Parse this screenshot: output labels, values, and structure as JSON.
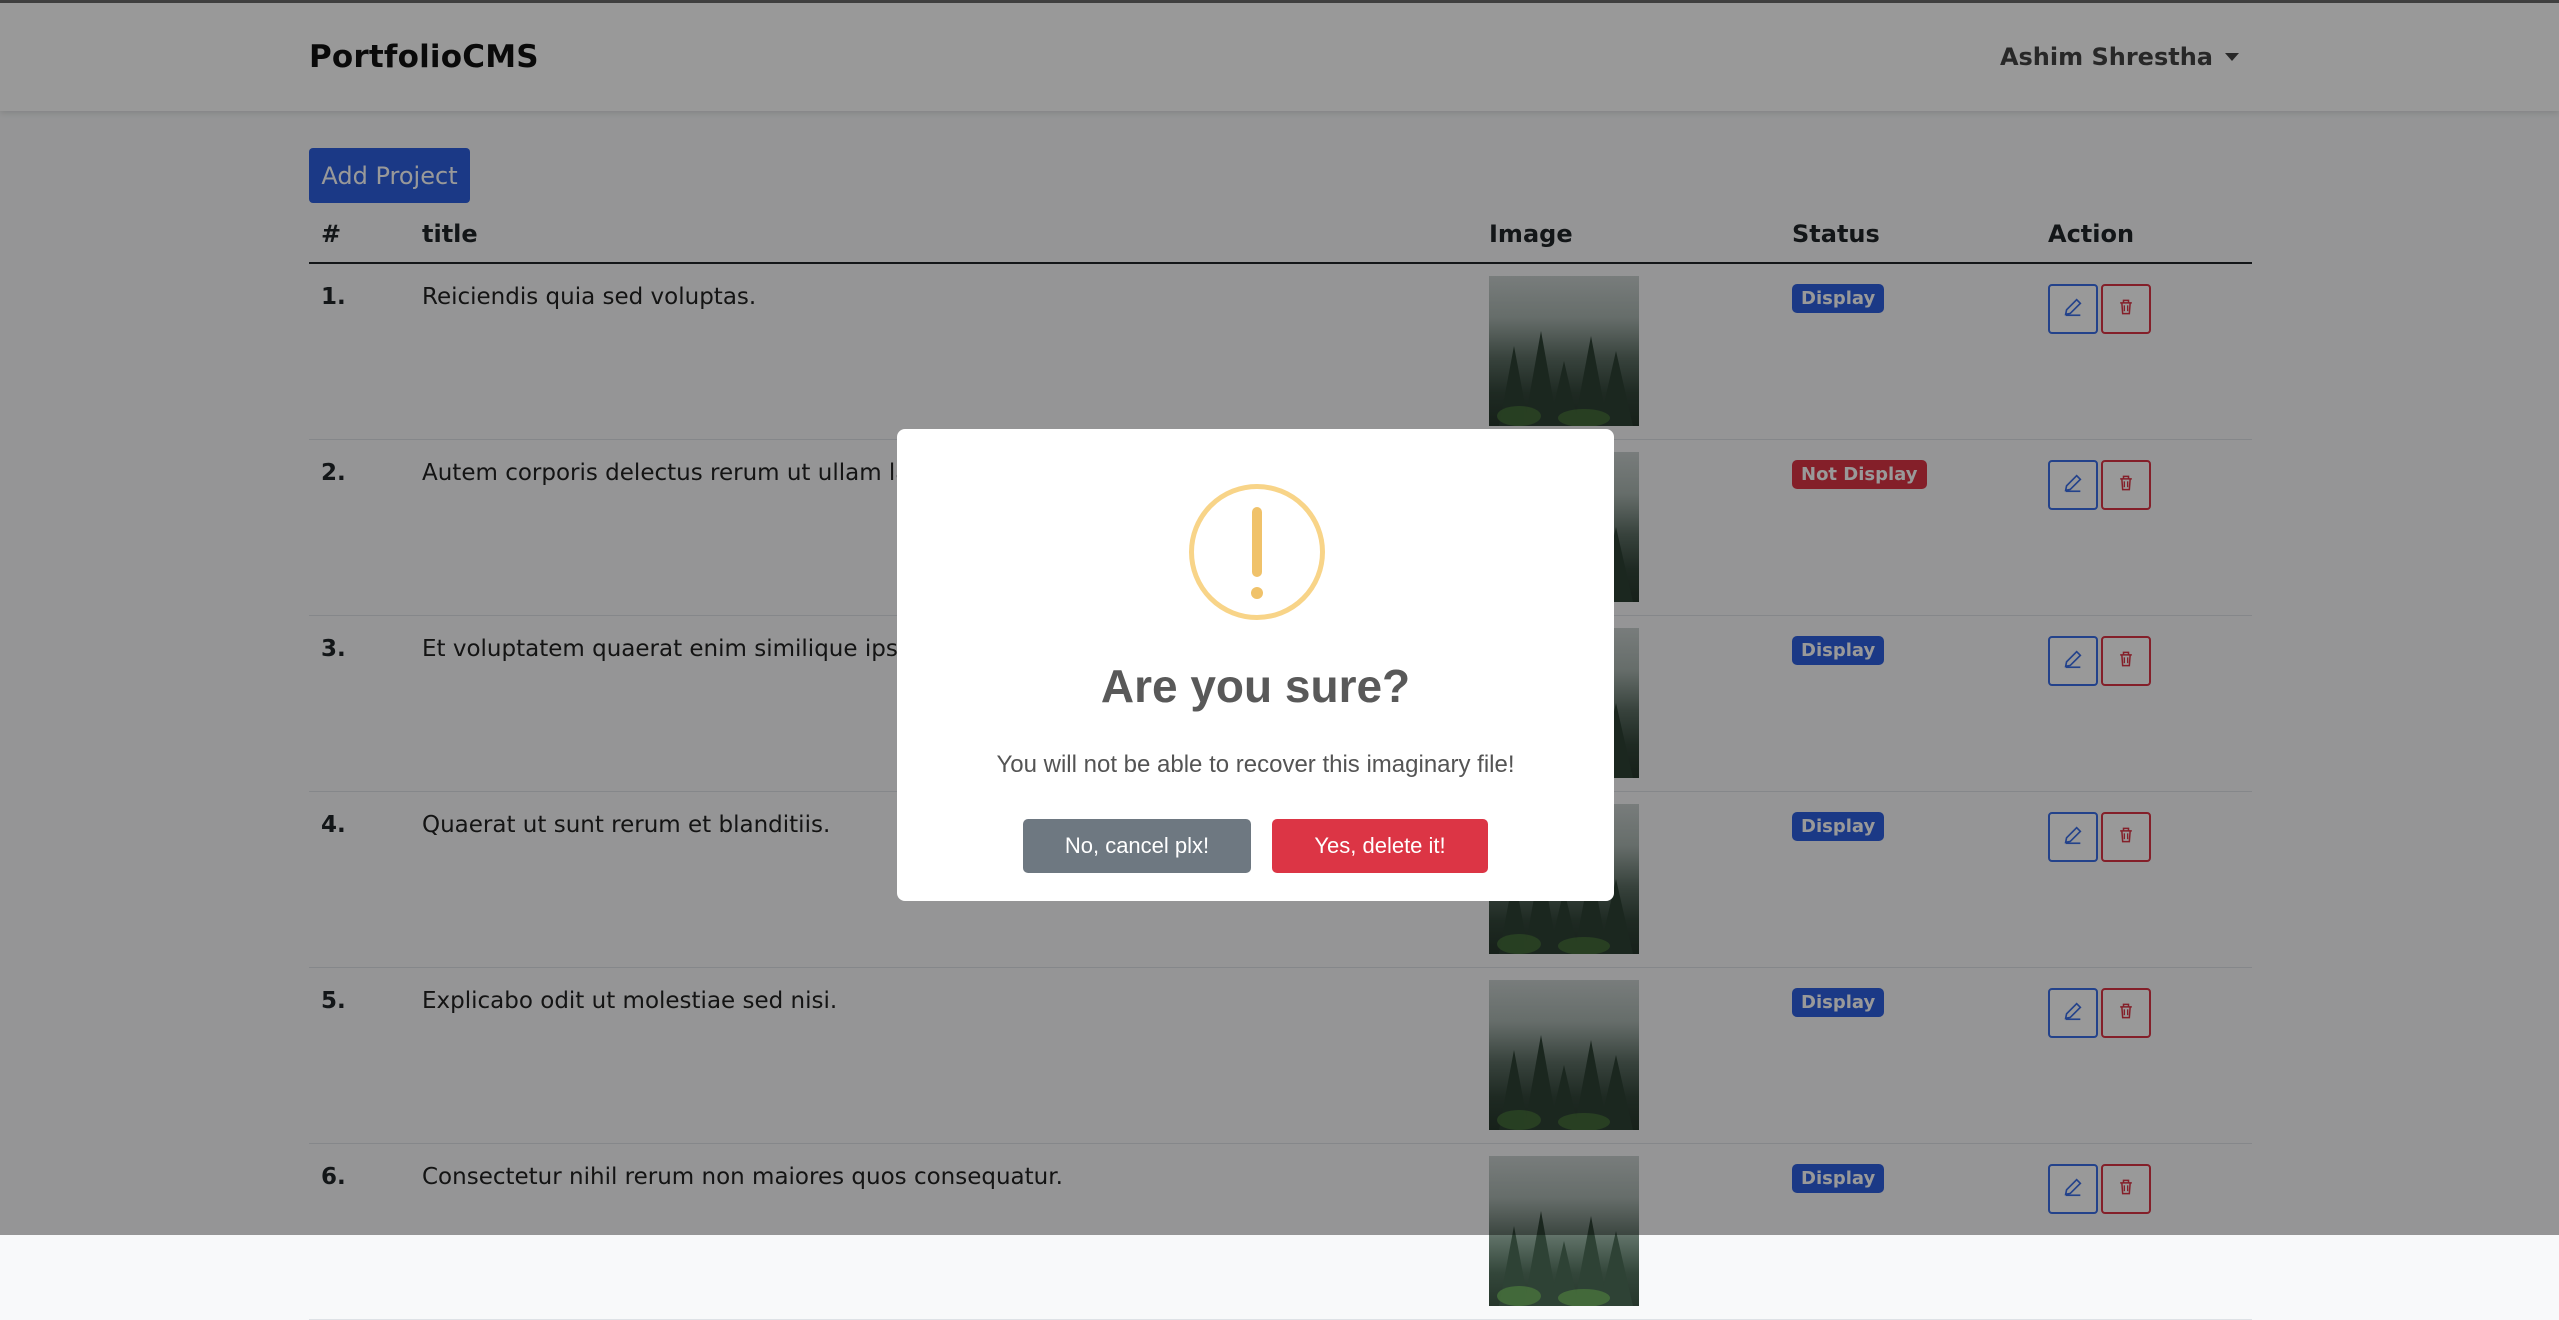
{
  "navbar": {
    "brand": "PortfolioCMS",
    "user": "Ashim Shrestha"
  },
  "actions": {
    "add_project": "Add Project"
  },
  "table": {
    "headers": {
      "num": "#",
      "title": "title",
      "image": "Image",
      "status": "Status",
      "action": "Action"
    },
    "rows": [
      {
        "num": "1.",
        "title": "Reiciendis quia sed voluptas.",
        "status": "Display"
      },
      {
        "num": "2.",
        "title": "Autem corporis delectus rerum ut ullam labo",
        "status": "Not Display"
      },
      {
        "num": "3.",
        "title": "Et voluptatem quaerat enim similique ipsam n",
        "status": "Display"
      },
      {
        "num": "4.",
        "title": "Quaerat ut sunt rerum et blanditiis.",
        "status": "Display"
      },
      {
        "num": "5.",
        "title": "Explicabo odit ut molestiae sed nisi.",
        "status": "Display"
      },
      {
        "num": "6.",
        "title": "Consectetur nihil rerum non maiores quos consequatur.",
        "status": "Display"
      }
    ]
  },
  "dialog": {
    "title": "Are you sure?",
    "text": "You will not be able to recover this imaginary file!",
    "cancel": "No, cancel plx!",
    "confirm": "Yes, delete it!"
  },
  "colors": {
    "primary": "#2d5fe0",
    "danger": "#dc3545",
    "warning_icon": "#f8d488",
    "cancel_button": "#6e7881"
  },
  "icons": {
    "edit": "pencil-icon",
    "delete": "trash-icon",
    "alert": "exclamation-icon"
  }
}
